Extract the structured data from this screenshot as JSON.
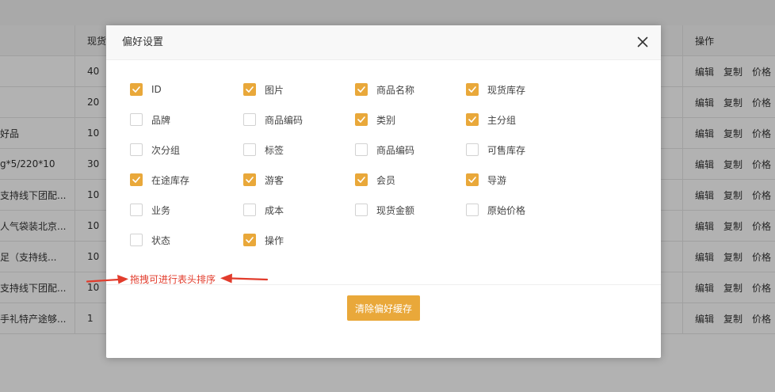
{
  "table": {
    "headers": {
      "stock": "现货",
      "ops": "操作"
    },
    "rows": [
      {
        "name": "",
        "stock": "40"
      },
      {
        "name": "",
        "stock": "20"
      },
      {
        "name": "好品",
        "stock": "10"
      },
      {
        "name": "g*5/220*10",
        "stock": "30"
      },
      {
        "name": "支持线下团配...",
        "stock": "10"
      },
      {
        "name": "人气袋装北京...",
        "stock": "10"
      },
      {
        "name": "足（支持线...",
        "stock": "10"
      },
      {
        "name": "支持线下团配...",
        "stock": "10"
      },
      {
        "name": "手礼特产途够...",
        "stock": "1"
      }
    ],
    "ops": {
      "edit": "编辑",
      "copy": "复制",
      "price": "价格"
    }
  },
  "modal": {
    "title": "偏好设置",
    "options": [
      {
        "label": "ID",
        "checked": true
      },
      {
        "label": "图片",
        "checked": true
      },
      {
        "label": "商品名称",
        "checked": true
      },
      {
        "label": "现货库存",
        "checked": true
      },
      {
        "label": "品牌",
        "checked": false
      },
      {
        "label": "商品编码",
        "checked": false
      },
      {
        "label": "类别",
        "checked": true
      },
      {
        "label": "主分组",
        "checked": true
      },
      {
        "label": "次分组",
        "checked": false
      },
      {
        "label": "标签",
        "checked": false
      },
      {
        "label": "商品编码",
        "checked": false
      },
      {
        "label": "可售库存",
        "checked": false
      },
      {
        "label": "在途库存",
        "checked": true
      },
      {
        "label": "游客",
        "checked": true
      },
      {
        "label": "会员",
        "checked": true
      },
      {
        "label": "导游",
        "checked": true
      },
      {
        "label": "业务",
        "checked": false
      },
      {
        "label": "成本",
        "checked": false
      },
      {
        "label": "现货金额",
        "checked": false
      },
      {
        "label": "原始价格",
        "checked": false
      },
      {
        "label": "状态",
        "checked": false
      },
      {
        "label": "操作",
        "checked": true
      }
    ],
    "hint": "拖拽可进行表头排序",
    "clear_button": "清除偏好缓存"
  },
  "colors": {
    "accent": "#e9a83a",
    "annotation": "#e23c2c"
  },
  "icons": {
    "close": "close-icon",
    "check": "checkmark-icon"
  }
}
